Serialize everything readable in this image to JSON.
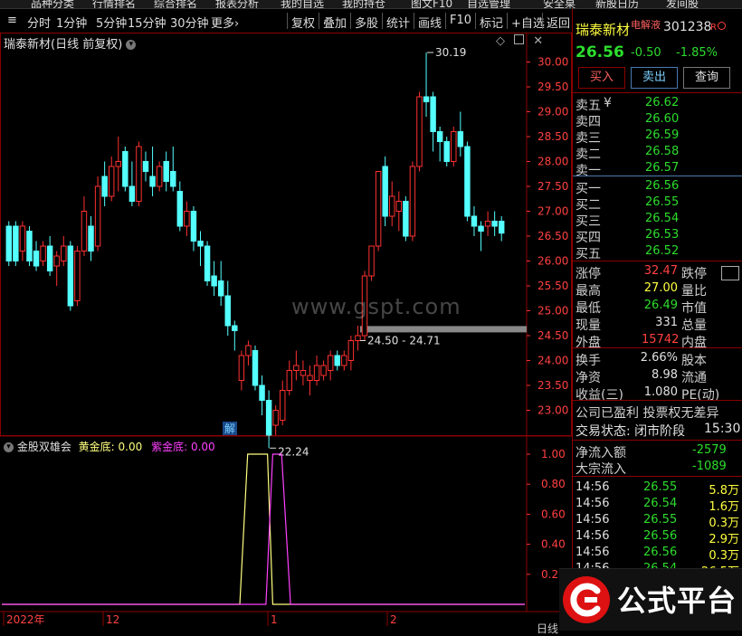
{
  "top_nav": [
    "品种分类",
    "行情排名",
    "综合排名",
    "报表分析",
    "我的自选",
    "我的持仓",
    "图文F10",
    "自选管理",
    "安全桌",
    "新股日历",
    "发间股"
  ],
  "period_tabs": [
    "分时",
    "1分钟",
    "5分钟",
    "15分钟",
    "30分钟",
    "更多›"
  ],
  "tool_tabs": [
    "复权",
    "叠加",
    "多股",
    "统计",
    "画线",
    "F10",
    "标记",
    "+自选",
    "返回"
  ],
  "chart_title": "瑞泰新材(日线 前复权)",
  "indicator": {
    "name": "金股双雄会",
    "label1": "黄金底:",
    "value1": "0.00",
    "label2": "紫金底:",
    "value2": "0.00"
  },
  "watermark": "www.gspt.com",
  "brand": "公式平台",
  "colors": {
    "up": "#ff3030",
    "down": "#54ffff",
    "yellow": "#ffff80",
    "purple": "#ff40ff",
    "grid": "#8b0000"
  },
  "chart_data": {
    "type": "candlestick",
    "y_ticks": [
      "30.00",
      "29.50",
      "29.00",
      "28.50",
      "28.00",
      "27.50",
      "27.00",
      "26.50",
      "26.00",
      "25.50",
      "25.00",
      "24.50",
      "24.00",
      "23.50",
      "23.00"
    ],
    "ylim": [
      22.5,
      30.3
    ],
    "x_labels": [
      "2022年",
      "12",
      "1",
      "2"
    ],
    "annotations": {
      "high": "30.19",
      "low": "22.24",
      "range": "24.50 - 24.71",
      "marker": "解"
    },
    "indicator_ticks": [
      "1.00",
      "0.80",
      "0.60",
      "0.40",
      "0.20"
    ],
    "candles": [
      {
        "o": 26.7,
        "h": 26.8,
        "c": 26.0,
        "l": 25.9
      },
      {
        "o": 26.7,
        "h": 26.8,
        "c": 26.0,
        "l": 25.9
      },
      {
        "o": 26.2,
        "h": 26.8,
        "c": 26.7,
        "l": 26.0
      },
      {
        "o": 26.6,
        "h": 26.7,
        "c": 26.0,
        "l": 25.9
      },
      {
        "o": 26.2,
        "h": 26.4,
        "c": 25.9,
        "l": 25.8
      },
      {
        "o": 26.0,
        "h": 26.4,
        "c": 26.3,
        "l": 25.9
      },
      {
        "o": 26.3,
        "h": 26.5,
        "c": 25.8,
        "l": 25.7
      },
      {
        "o": 25.9,
        "h": 26.2,
        "c": 26.1,
        "l": 25.5
      },
      {
        "o": 26.0,
        "h": 26.5,
        "c": 26.3,
        "l": 25.9
      },
      {
        "o": 26.3,
        "h": 26.4,
        "c": 25.1,
        "l": 25.0
      },
      {
        "o": 25.2,
        "h": 26.3,
        "c": 26.2,
        "l": 25.1
      },
      {
        "o": 26.2,
        "h": 27.3,
        "c": 27.0,
        "l": 26.1
      },
      {
        "o": 26.7,
        "h": 26.9,
        "c": 26.2,
        "l": 26.0
      },
      {
        "o": 26.3,
        "h": 27.7,
        "c": 27.5,
        "l": 26.2
      },
      {
        "o": 27.7,
        "h": 28.0,
        "c": 27.3,
        "l": 27.1
      },
      {
        "o": 27.3,
        "h": 28.1,
        "c": 27.9,
        "l": 27.2
      },
      {
        "o": 27.9,
        "h": 28.5,
        "c": 28.0,
        "l": 27.4
      },
      {
        "o": 28.2,
        "h": 28.3,
        "c": 27.5,
        "l": 27.4
      },
      {
        "o": 27.5,
        "h": 28.0,
        "c": 27.2,
        "l": 27.1
      },
      {
        "o": 27.2,
        "h": 28.4,
        "c": 28.3,
        "l": 27.1
      },
      {
        "o": 28.0,
        "h": 28.2,
        "c": 27.8,
        "l": 27.6
      },
      {
        "o": 27.7,
        "h": 28.3,
        "c": 27.5,
        "l": 27.3
      },
      {
        "o": 27.5,
        "h": 28.0,
        "c": 27.9,
        "l": 27.4
      },
      {
        "o": 28.0,
        "h": 28.2,
        "c": 27.6,
        "l": 27.4
      },
      {
        "o": 27.8,
        "h": 28.3,
        "c": 27.5,
        "l": 27.4
      },
      {
        "o": 27.4,
        "h": 27.6,
        "c": 26.7,
        "l": 26.6
      },
      {
        "o": 26.7,
        "h": 27.2,
        "c": 27.0,
        "l": 26.5
      },
      {
        "o": 27.0,
        "h": 27.1,
        "c": 26.4,
        "l": 26.2
      },
      {
        "o": 26.4,
        "h": 26.6,
        "c": 26.3,
        "l": 25.9
      },
      {
        "o": 26.3,
        "h": 26.4,
        "c": 25.6,
        "l": 25.5
      },
      {
        "o": 25.7,
        "h": 26.0,
        "c": 25.5,
        "l": 25.3
      },
      {
        "o": 25.6,
        "h": 26.0,
        "c": 25.3,
        "l": 25.1
      },
      {
        "o": 25.3,
        "h": 25.6,
        "c": 24.7,
        "l": 24.5
      },
      {
        "o": 24.7,
        "h": 24.8,
        "c": 24.6,
        "l": 24.2
      },
      {
        "o": 23.6,
        "h": 24.2,
        "c": 24.1,
        "l": 23.4
      },
      {
        "o": 24.1,
        "h": 24.4,
        "c": 24.3,
        "l": 23.9
      },
      {
        "o": 24.2,
        "h": 24.3,
        "c": 23.5,
        "l": 23.4
      },
      {
        "o": 23.5,
        "h": 23.7,
        "c": 23.2,
        "l": 22.9
      },
      {
        "o": 23.2,
        "h": 23.4,
        "c": 22.5,
        "l": 22.24
      },
      {
        "o": 22.7,
        "h": 23.1,
        "c": 23.0,
        "l": 22.5
      },
      {
        "o": 22.8,
        "h": 23.6,
        "c": 23.4,
        "l": 22.7
      },
      {
        "o": 23.4,
        "h": 24.0,
        "c": 23.8,
        "l": 23.3
      },
      {
        "o": 23.8,
        "h": 24.2,
        "c": 23.9,
        "l": 23.6
      },
      {
        "o": 23.7,
        "h": 24.0,
        "c": 23.8,
        "l": 23.5
      },
      {
        "o": 23.6,
        "h": 23.9,
        "c": 23.7,
        "l": 23.3
      },
      {
        "o": 23.6,
        "h": 24.1,
        "c": 23.9,
        "l": 23.5
      },
      {
        "o": 23.7,
        "h": 24.0,
        "c": 23.9,
        "l": 23.6
      },
      {
        "o": 23.8,
        "h": 24.2,
        "c": 24.1,
        "l": 23.6
      },
      {
        "o": 24.1,
        "h": 24.2,
        "c": 23.9,
        "l": 23.8
      },
      {
        "o": 23.9,
        "h": 24.2,
        "c": 24.1,
        "l": 23.8
      },
      {
        "o": 24.0,
        "h": 24.5,
        "c": 24.4,
        "l": 23.8
      },
      {
        "o": 24.4,
        "h": 24.7,
        "c": 24.5,
        "l": 24.2
      },
      {
        "o": 24.5,
        "h": 25.8,
        "c": 25.7,
        "l": 24.4
      },
      {
        "o": 25.7,
        "h": 26.3,
        "c": 26.3,
        "l": 25.6
      },
      {
        "o": 26.3,
        "h": 26.4,
        "c": 27.8,
        "l": 26.2
      },
      {
        "o": 27.9,
        "h": 28.1,
        "c": 26.9,
        "l": 26.7
      },
      {
        "o": 26.9,
        "h": 27.6,
        "c": 27.3,
        "l": 26.7
      },
      {
        "o": 27.0,
        "h": 27.4,
        "c": 27.2,
        "l": 26.6
      },
      {
        "o": 27.2,
        "h": 27.3,
        "c": 26.5,
        "l": 26.4
      },
      {
        "o": 26.5,
        "h": 28.0,
        "c": 27.9,
        "l": 26.4
      },
      {
        "o": 27.9,
        "h": 29.4,
        "c": 29.3,
        "l": 27.8
      },
      {
        "o": 29.3,
        "h": 30.19,
        "c": 29.2,
        "l": 28.9
      },
      {
        "o": 29.3,
        "h": 29.4,
        "c": 28.6,
        "l": 28.2
      },
      {
        "o": 28.6,
        "h": 28.7,
        "c": 28.4,
        "l": 28.0
      },
      {
        "o": 28.4,
        "h": 28.5,
        "c": 28.0,
        "l": 27.9
      },
      {
        "o": 28.0,
        "h": 28.7,
        "c": 28.6,
        "l": 27.9
      },
      {
        "o": 28.6,
        "h": 29.0,
        "c": 28.3,
        "l": 28.1
      },
      {
        "o": 28.3,
        "h": 28.4,
        "c": 26.9,
        "l": 26.8
      },
      {
        "o": 26.9,
        "h": 27.1,
        "c": 26.7,
        "l": 26.5
      },
      {
        "o": 26.7,
        "h": 26.8,
        "c": 26.6,
        "l": 26.2
      },
      {
        "o": 26.7,
        "h": 27.0,
        "c": 26.8,
        "l": 26.5
      },
      {
        "o": 26.8,
        "h": 27.0,
        "c": 26.7,
        "l": 26.5
      },
      {
        "o": 26.8,
        "h": 26.9,
        "c": 26.56,
        "l": 26.4
      }
    ],
    "yellow_line": [
      {
        "x": 0.0,
        "v": 0.0
      },
      {
        "x": 0.455,
        "v": 0.0
      },
      {
        "x": 0.47,
        "v": 1.0
      },
      {
        "x": 0.508,
        "v": 1.0
      },
      {
        "x": 0.518,
        "v": 0.0
      },
      {
        "x": 1.0,
        "v": 0.0
      }
    ],
    "purple_line": [
      {
        "x": 0.0,
        "v": 0.0
      },
      {
        "x": 0.505,
        "v": 0.0
      },
      {
        "x": 0.518,
        "v": 1.0
      },
      {
        "x": 0.535,
        "v": 1.0
      },
      {
        "x": 0.552,
        "v": 0.0
      },
      {
        "x": 1.0,
        "v": 0.0
      }
    ]
  },
  "quote": {
    "name": "瑞泰新材",
    "tag": "电解液",
    "code": "301238",
    "flag": "R",
    "price": "26.56",
    "change": "-0.50",
    "pct": "-1.85%",
    "buttons": [
      "买入",
      "卖出",
      "查询"
    ],
    "asks": [
      {
        "label": "卖五",
        "price": "26.62"
      },
      {
        "label": "卖四",
        "price": "26.60"
      },
      {
        "label": "卖三",
        "price": "26.59"
      },
      {
        "label": "卖二",
        "price": "26.58"
      },
      {
        "label": "卖一",
        "price": "26.57"
      }
    ],
    "bids": [
      {
        "label": "买一",
        "price": "26.56"
      },
      {
        "label": "买二",
        "price": "26.55"
      },
      {
        "label": "买三",
        "price": "26.54"
      },
      {
        "label": "买四",
        "price": "26.53"
      },
      {
        "label": "买五",
        "price": "26.52"
      }
    ],
    "stats": [
      {
        "l1": "涨停",
        "v1": "32.47",
        "l2": "跌停"
      },
      {
        "l1": "最高",
        "v1": "27.00",
        "l2": "量比"
      },
      {
        "l1": "最低",
        "v1": "26.49",
        "l2": "市值"
      },
      {
        "l1": "现量",
        "v1": "331",
        "l2": "总量"
      },
      {
        "l1": "外盘",
        "v1": "15742",
        "l2": "内盘"
      }
    ],
    "stats2": [
      {
        "l1": "换手",
        "v1": "2.66%",
        "l2": "股本"
      },
      {
        "l1": "净资",
        "v1": "8.98",
        "l2": "流通"
      },
      {
        "l1": "收益(三)",
        "v1": "1.080",
        "l2": "PE(动)"
      }
    ],
    "notice": "公司已盈利 投票权无差异",
    "trade_status": "交易状态: 闭市阶段",
    "trade_time": "15:30",
    "flows": [
      {
        "label": "净流入额",
        "value": "-2579"
      },
      {
        "label": "大宗流入",
        "value": "-1089"
      }
    ],
    "ticks": [
      {
        "t": "14:56",
        "p": "26.55",
        "v": "5.8万"
      },
      {
        "t": "14:56",
        "p": "26.54",
        "v": "1.6万"
      },
      {
        "t": "14:56",
        "p": "26.55",
        "v": "0.3万"
      },
      {
        "t": "14:56",
        "p": "26.56",
        "v": "2.9万"
      },
      {
        "t": "14:56",
        "p": "26.56",
        "v": "0.3万"
      },
      {
        "t": "14:56",
        "p": "26.54",
        "v": "26.5万"
      }
    ],
    "bottom_tab": "日线"
  }
}
